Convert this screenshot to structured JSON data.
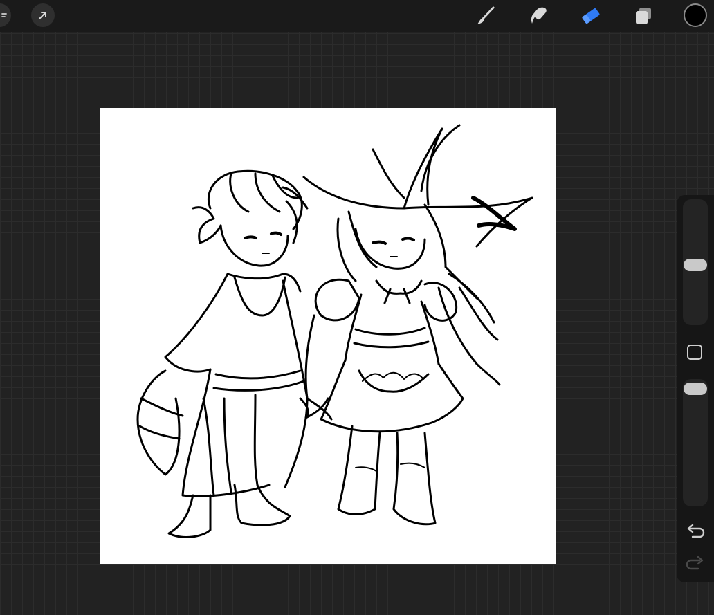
{
  "app": "Procreate",
  "toolbar": {
    "left_tools": [
      {
        "name": "adjustments",
        "icon": "adjustments-icon"
      },
      {
        "name": "selection",
        "icon": "selection-arrow-icon"
      }
    ],
    "right_tools": [
      {
        "name": "brush",
        "icon": "brush-icon",
        "active": false
      },
      {
        "name": "smudge",
        "icon": "smudge-icon",
        "active": false
      },
      {
        "name": "eraser",
        "icon": "eraser-icon",
        "active": true
      },
      {
        "name": "layers",
        "icon": "layers-icon",
        "active": false
      }
    ],
    "current_color": "#000000",
    "active_color": "#2f7bf6"
  },
  "canvas": {
    "background": "#ffffff",
    "content": "sketch-two-chibi-characters"
  },
  "sidebar": {
    "size_slider": 0.72,
    "opacity_slider": 0.0,
    "modify_button": "square-modify-icon",
    "undo_icon": "undo-icon",
    "redo_icon": "redo-icon"
  }
}
